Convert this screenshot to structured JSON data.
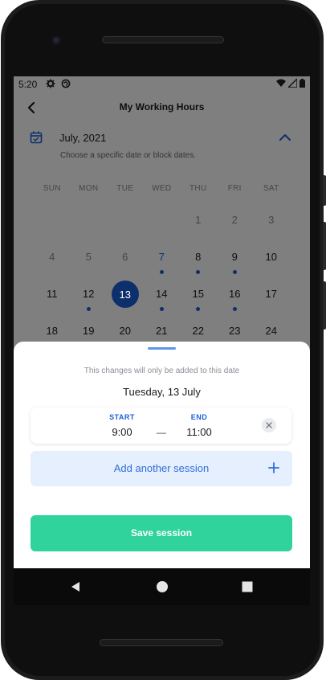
{
  "status_bar": {
    "time": "5:20"
  },
  "app_bar": {
    "title": "My Working Hours"
  },
  "calendar": {
    "month_label": "July, 2021",
    "hint": "Choose a specific date or block dates.",
    "weekdays": [
      "SUN",
      "MON",
      "TUE",
      "WED",
      "THU",
      "FRI",
      "SAT"
    ],
    "rows": [
      [
        {
          "label": ""
        },
        {
          "label": ""
        },
        {
          "label": ""
        },
        {
          "label": ""
        },
        {
          "label": "1",
          "muted": true
        },
        {
          "label": "2",
          "muted": true
        },
        {
          "label": "3",
          "muted": true
        }
      ],
      [
        {
          "label": "4",
          "muted": true
        },
        {
          "label": "5",
          "muted": true
        },
        {
          "label": "6",
          "muted": true
        },
        {
          "label": "7",
          "blue": true,
          "dot": true
        },
        {
          "label": "8",
          "dot": true
        },
        {
          "label": "9",
          "dot": true
        },
        {
          "label": "10"
        }
      ],
      [
        {
          "label": "11"
        },
        {
          "label": "12",
          "dot": true
        },
        {
          "label": "13",
          "selected": true
        },
        {
          "label": "14",
          "dot": true
        },
        {
          "label": "15",
          "dot": true
        },
        {
          "label": "16",
          "dot": true
        },
        {
          "label": "17"
        }
      ],
      [
        {
          "label": "18"
        },
        {
          "label": "19"
        },
        {
          "label": "20"
        },
        {
          "label": "21"
        },
        {
          "label": "22"
        },
        {
          "label": "23"
        },
        {
          "label": "24"
        }
      ]
    ]
  },
  "sheet": {
    "note": "This changes will only be added to this date",
    "date": "Tuesday, 13 July",
    "session": {
      "start_label": "START",
      "start_value": "9:00",
      "separator": "—",
      "end_label": "END",
      "end_value": "11:00"
    },
    "add_session_label": "Add another session",
    "save_label": "Save session"
  },
  "colors": {
    "accent_blue": "#1b5fd8",
    "save_green": "#2fd39b",
    "add_bg": "#e6effe"
  }
}
